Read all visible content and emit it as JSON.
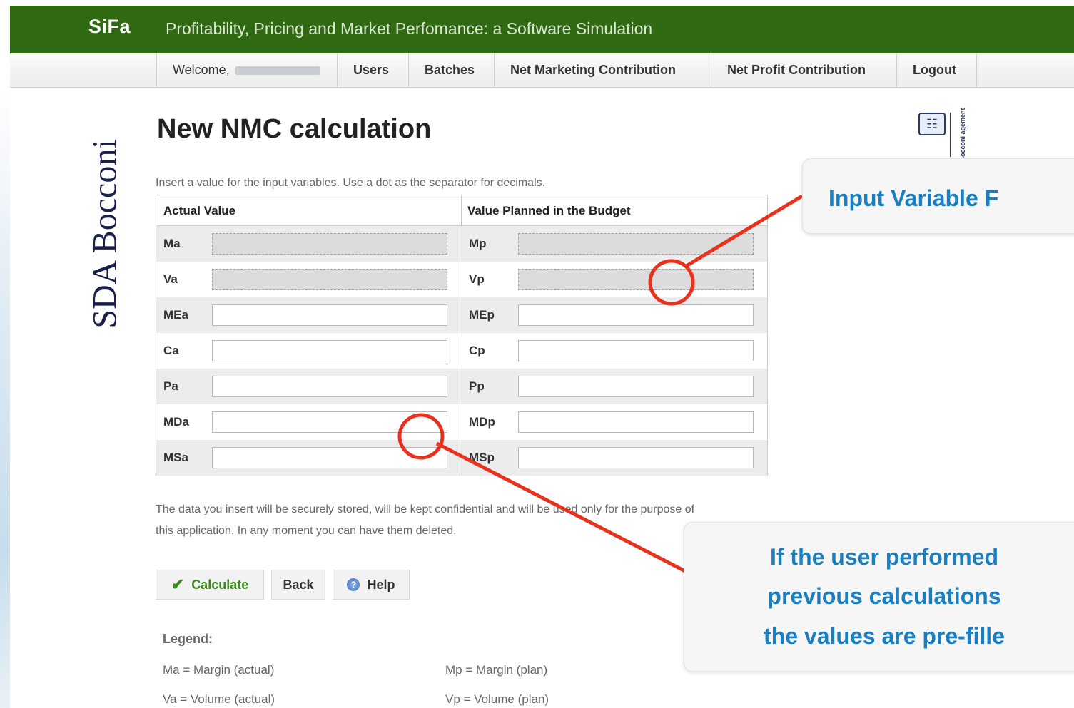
{
  "header": {
    "logo": "SiFa",
    "tagline": "Profitability, Pricing and Market Perfomance: a Software Simulation"
  },
  "nav": {
    "welcome": "Welcome,",
    "items": [
      "Users",
      "Batches",
      "Net Marketing Contribution",
      "Net Profit Contribution",
      "Logout"
    ]
  },
  "brand": {
    "sidebar_text": "SDA Bocconi",
    "top_logo_text": "Bocconi\nagement"
  },
  "page": {
    "title": "New NMC calculation",
    "hint": "Insert a value for the input variables. Use a dot as the separator for decimals.",
    "disclaimer": "The data you insert will be securely stored, will be kept confidential and will be used only for the purpose of this application. In any moment you can have them deleted."
  },
  "table": {
    "header_actual": "Actual Value",
    "header_planned": "Value Planned in the Budget",
    "rows": [
      {
        "actual_label": "Ma",
        "planned_label": "Mp",
        "actual_value": "",
        "planned_value": "",
        "disabled": true
      },
      {
        "actual_label": "Va",
        "planned_label": "Vp",
        "actual_value": "",
        "planned_value": "",
        "disabled": true
      },
      {
        "actual_label": "MEa",
        "planned_label": "MEp",
        "actual_value": "",
        "planned_value": "",
        "disabled": false
      },
      {
        "actual_label": "Ca",
        "planned_label": "Cp",
        "actual_value": "",
        "planned_value": "",
        "disabled": false
      },
      {
        "actual_label": "Pa",
        "planned_label": "Pp",
        "actual_value": "",
        "planned_value": "",
        "disabled": false
      },
      {
        "actual_label": "MDa",
        "planned_label": "MDp",
        "actual_value": "",
        "planned_value": "",
        "disabled": false
      },
      {
        "actual_label": "MSa",
        "planned_label": "MSp",
        "actual_value": "",
        "planned_value": "",
        "disabled": false
      }
    ]
  },
  "buttons": {
    "calculate": "Calculate",
    "back": "Back",
    "help": "Help"
  },
  "legend": {
    "title": "Legend:",
    "items": [
      "Ma = Margin (actual)",
      "Mp = Margin (plan)",
      "Va = Volume (actual)",
      "Vp = Volume (plan)"
    ]
  },
  "callouts": {
    "input_fields": "Input Variable F",
    "prefill_lines": [
      "If the user performed",
      "previous calculations",
      "the values are pre-fille"
    ]
  },
  "colors": {
    "header_green": "#2f6a12",
    "callout_blue": "#1a7fc0",
    "annotation_red": "#e8321e"
  }
}
